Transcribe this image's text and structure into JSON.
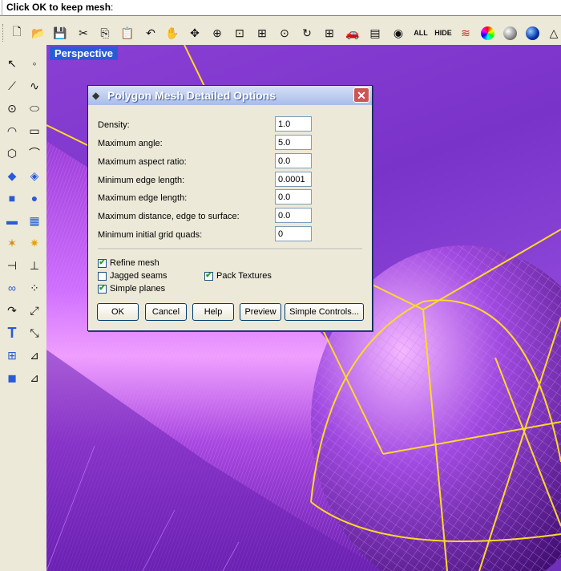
{
  "command_prompt": {
    "bold": "Click OK to keep mesh",
    "suffix": ":"
  },
  "toolbar": {
    "icons": [
      "new-file",
      "open-folder",
      "save",
      "cut",
      "copy",
      "paste",
      "undo",
      "pan-hand",
      "rotate-view",
      "zoom-window",
      "zoom-dynamic",
      "zoom-extents",
      "zoom-selected",
      "undo-view",
      "four-viewports",
      "car-render",
      "layers",
      "show-object"
    ],
    "all_label": "ALL",
    "hide_label": "HIDE"
  },
  "viewport": {
    "title": "Perspective"
  },
  "dialog": {
    "title": "Polygon Mesh Detailed Options",
    "fields": [
      {
        "label": "Density:",
        "value": "1.0"
      },
      {
        "label": "Maximum angle:",
        "value": "5.0"
      },
      {
        "label": "Maximum aspect ratio:",
        "value": "0.0"
      },
      {
        "label": "Minimum edge length:",
        "value": "0.0001"
      },
      {
        "label": "Maximum edge length:",
        "value": "0.0"
      },
      {
        "label": "Maximum distance, edge to surface:",
        "value": "0.0"
      },
      {
        "label": "Minimum initial grid quads:",
        "value": "0"
      }
    ],
    "checkboxes": {
      "refine_mesh": {
        "label": "Refine mesh",
        "checked": true
      },
      "jagged_seams": {
        "label": "Jagged seams",
        "checked": false
      },
      "simple_planes": {
        "label": "Simple planes",
        "checked": true
      },
      "pack_textures": {
        "label": "Pack Textures",
        "checked": true
      }
    },
    "buttons": {
      "ok": "OK",
      "cancel": "Cancel",
      "help": "Help",
      "preview": "Preview",
      "simple_controls": "Simple Controls..."
    }
  }
}
